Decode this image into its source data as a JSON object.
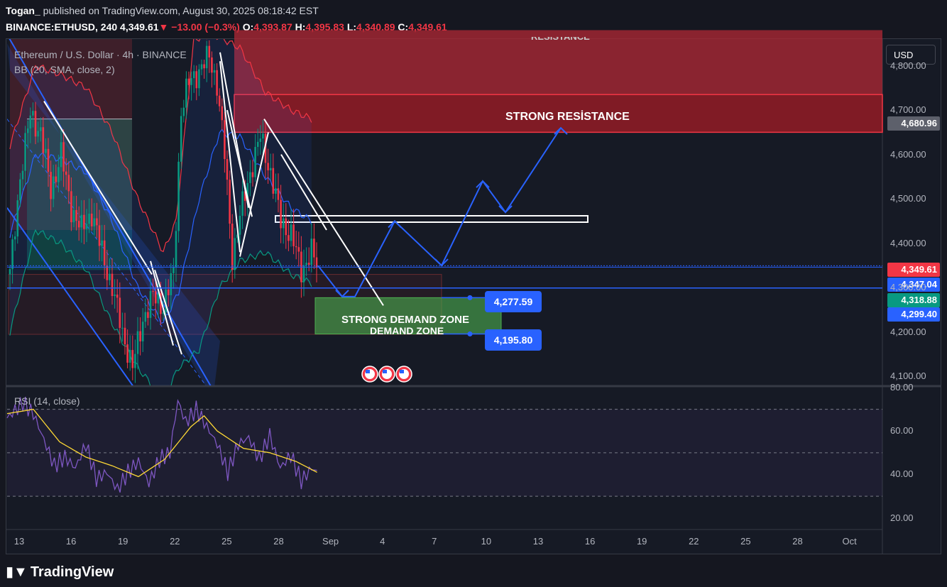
{
  "header": {
    "author": "Togan_",
    "published": "published on TradingView.com, August 30, 2025 08:18:42 EST",
    "symbol": "BINANCE:ETHUSD, 240",
    "last": "4,349.61",
    "arrow": "▼",
    "change": "−13.00 (−0.3%)",
    "o_label": "O:",
    "o": "4,393.87",
    "h_label": "H:",
    "h": "4,395.83",
    "l_label": "L:",
    "l": "4,340.89",
    "c_label": "C:",
    "c": "4,349.61"
  },
  "legend": {
    "title": "Ethereum / U.S. Dollar · 4h · BINANCE",
    "bb": "BB (20, SMA, close, 2)",
    "rsi": "RSI (14, close)"
  },
  "currency_button": "USD",
  "annotations": {
    "strong_resistance": "STRONG RESİSTANCE",
    "strong_demand": "STRONG DEMAND ZONE",
    "demand": "DEMAND ZONE",
    "top_label": "RESISTANCE",
    "callout_upper": "4,277.59",
    "callout_lower": "4,195.80"
  },
  "price_tags": [
    {
      "value": "4,680.96",
      "color": "#5d606b"
    },
    {
      "value": "4,349.61",
      "color": "#f23645"
    },
    {
      "value": "4,347.04",
      "color": "#2962ff"
    },
    {
      "value": "4,318.88",
      "color": "#089981"
    },
    {
      "value": "4,299.40",
      "color": "#2962ff"
    }
  ],
  "colors": {
    "up": "#089981",
    "down": "#f23645",
    "bb_upper": "#f23645",
    "bb_basis": "#2962ff",
    "bb_lower": "#089981",
    "rsi": "#7e57c2",
    "rsi_ma": "#fdd835",
    "projection": "#2962ff"
  },
  "footer": "TradingView",
  "chart_data": [
    {
      "type": "candlestick",
      "title": "Ethereum / U.S. Dollar · 4h · BINANCE",
      "ylim": [
        4080,
        4860
      ],
      "y_ticks": [
        "4,800.00",
        "4,700.00",
        "4,600.00",
        "4,500.00",
        "4,400.00",
        "4,300.00",
        "4,200.00",
        "4,100.00"
      ],
      "x_ticks": [
        "13",
        "16",
        "19",
        "22",
        "25",
        "28",
        "Sep",
        "4",
        "7",
        "10",
        "13",
        "16",
        "19",
        "22",
        "25",
        "28",
        "Oct"
      ],
      "close_path": [
        [
          0,
          4330
        ],
        [
          4,
          4550
        ],
        [
          8,
          4690
        ],
        [
          12,
          4650
        ],
        [
          16,
          4520
        ],
        [
          20,
          4600
        ],
        [
          24,
          4480
        ],
        [
          28,
          4430
        ],
        [
          32,
          4470
        ],
        [
          36,
          4380
        ],
        [
          40,
          4300
        ],
        [
          44,
          4200
        ],
        [
          48,
          4120
        ],
        [
          52,
          4230
        ],
        [
          56,
          4280
        ],
        [
          60,
          4260
        ],
        [
          64,
          4330
        ],
        [
          67,
          4700
        ],
        [
          70,
          4760
        ],
        [
          74,
          4790
        ],
        [
          78,
          4820
        ],
        [
          81,
          4760
        ],
        [
          84,
          4600
        ],
        [
          87,
          4370
        ],
        [
          90,
          4460
        ],
        [
          94,
          4560
        ],
        [
          98,
          4640
        ],
        [
          102,
          4560
        ],
        [
          106,
          4450
        ],
        [
          110,
          4420
        ],
        [
          114,
          4340
        ],
        [
          118,
          4380
        ],
        [
          120,
          4350
        ]
      ],
      "bollinger": {
        "upper": [
          [
            0,
            4620
          ],
          [
            10,
            4800
          ],
          [
            20,
            4780
          ],
          [
            30,
            4750
          ],
          [
            40,
            4650
          ],
          [
            50,
            4500
          ],
          [
            60,
            4380
          ],
          [
            65,
            4450
          ],
          [
            72,
            4860
          ],
          [
            80,
            4870
          ],
          [
            90,
            4840
          ],
          [
            100,
            4740
          ],
          [
            110,
            4700
          ],
          [
            118,
            4680
          ]
        ],
        "basis": [
          [
            0,
            4420
          ],
          [
            10,
            4600
          ],
          [
            20,
            4590
          ],
          [
            30,
            4560
          ],
          [
            40,
            4450
          ],
          [
            50,
            4300
          ],
          [
            60,
            4220
          ],
          [
            66,
            4290
          ],
          [
            74,
            4500
          ],
          [
            82,
            4650
          ],
          [
            90,
            4640
          ],
          [
            100,
            4550
          ],
          [
            110,
            4480
          ],
          [
            118,
            4450
          ]
        ],
        "lower": [
          [
            0,
            4200
          ],
          [
            10,
            4430
          ],
          [
            20,
            4400
          ],
          [
            30,
            4340
          ],
          [
            40,
            4220
          ],
          [
            50,
            4120
          ],
          [
            60,
            4050
          ],
          [
            66,
            4120
          ],
          [
            74,
            4160
          ],
          [
            82,
            4300
          ],
          [
            90,
            4360
          ],
          [
            100,
            4380
          ],
          [
            110,
            4330
          ],
          [
            118,
            4310
          ]
        ]
      },
      "levels": {
        "resistance_zone": [
          4650,
          4860
        ],
        "strong_resistance_band": [
          4650,
          4740
        ],
        "demand_zone": [
          4195.8,
          4277.59
        ],
        "box_level": [
          4450,
          4460
        ],
        "last_price": 4349.61,
        "support_line": 4299.4,
        "target": 4680.96
      },
      "projection_path": [
        [
          "Aug 30",
          4349.61
        ],
        [
          "Sep 1",
          4280
        ],
        [
          "Sep 4",
          4450
        ],
        [
          "Sep 7",
          4350
        ],
        [
          "Sep 9",
          4540
        ],
        [
          "Sep 10",
          4470
        ],
        [
          "Sep 13",
          4660
        ]
      ]
    },
    {
      "type": "line",
      "title": "RSI (14, close)",
      "ylim": [
        15,
        80
      ],
      "y_ticks": [
        "80.00",
        "60.00",
        "40.00",
        "20.00"
      ],
      "bands": [
        30,
        50,
        70
      ],
      "series": [
        {
          "name": "RSI",
          "values": [
            [
              0,
              66
            ],
            [
              6,
              73
            ],
            [
              10,
              68
            ],
            [
              14,
              56
            ],
            [
              18,
              44
            ],
            [
              22,
              48
            ],
            [
              26,
              43
            ],
            [
              30,
              54
            ],
            [
              34,
              38
            ],
            [
              38,
              41
            ],
            [
              42,
              33
            ],
            [
              46,
              41
            ],
            [
              50,
              46
            ],
            [
              54,
              36
            ],
            [
              58,
              47
            ],
            [
              62,
              50
            ],
            [
              65,
              74
            ],
            [
              68,
              64
            ],
            [
              72,
              70
            ],
            [
              76,
              62
            ],
            [
              80,
              54
            ],
            [
              84,
              41
            ],
            [
              88,
              54
            ],
            [
              92,
              57
            ],
            [
              96,
              47
            ],
            [
              100,
              58
            ],
            [
              104,
              43
            ],
            [
              108,
              49
            ],
            [
              112,
              37
            ],
            [
              116,
              43
            ],
            [
              118,
              41
            ]
          ]
        },
        {
          "name": "RSI-based MA",
          "values": [
            [
              0,
              68
            ],
            [
              10,
              70
            ],
            [
              20,
              55
            ],
            [
              30,
              48
            ],
            [
              40,
              44
            ],
            [
              50,
              39
            ],
            [
              60,
              47
            ],
            [
              70,
              62
            ],
            [
              75,
              67
            ],
            [
              80,
              60
            ],
            [
              90,
              52
            ],
            [
              100,
              50
            ],
            [
              110,
              46
            ],
            [
              118,
              41
            ]
          ]
        }
      ]
    }
  ]
}
